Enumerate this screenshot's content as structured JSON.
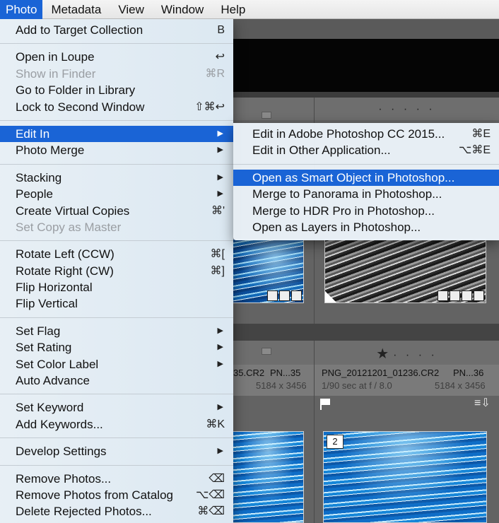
{
  "menubar": {
    "items": [
      {
        "label": "Photo",
        "active": true
      },
      {
        "label": "Metadata"
      },
      {
        "label": "View"
      },
      {
        "label": "Window"
      },
      {
        "label": "Help"
      }
    ]
  },
  "photo_menu": {
    "groups": [
      [
        {
          "label": "Add to Target Collection",
          "shortcut": "B"
        }
      ],
      [
        {
          "label": "Open in Loupe",
          "shortcut": "↩"
        },
        {
          "label": "Show in Finder",
          "shortcut": "⌘R",
          "disabled": true
        },
        {
          "label": "Go to Folder in Library",
          "shortcut": ""
        },
        {
          "label": "Lock to Second Window",
          "shortcut": "⇧⌘↩"
        }
      ],
      [
        {
          "label": "Edit In",
          "submenu": true,
          "highlighted": true
        },
        {
          "label": "Photo Merge",
          "submenu": true
        }
      ],
      [
        {
          "label": "Stacking",
          "submenu": true
        },
        {
          "label": "People",
          "submenu": true
        },
        {
          "label": "Create Virtual Copies",
          "shortcut": "⌘'"
        },
        {
          "label": "Set Copy as Master",
          "shortcut": "",
          "disabled": true
        }
      ],
      [
        {
          "label": "Rotate Left (CCW)",
          "shortcut": "⌘["
        },
        {
          "label": "Rotate Right (CW)",
          "shortcut": "⌘]"
        },
        {
          "label": "Flip Horizontal",
          "shortcut": ""
        },
        {
          "label": "Flip Vertical",
          "shortcut": ""
        }
      ],
      [
        {
          "label": "Set Flag",
          "submenu": true
        },
        {
          "label": "Set Rating",
          "submenu": true
        },
        {
          "label": "Set Color Label",
          "submenu": true
        },
        {
          "label": "Auto Advance",
          "shortcut": ""
        }
      ],
      [
        {
          "label": "Set Keyword",
          "submenu": true
        },
        {
          "label": "Add Keywords...",
          "shortcut": "⌘K"
        }
      ],
      [
        {
          "label": "Develop Settings",
          "submenu": true
        }
      ],
      [
        {
          "label": "Remove Photos...",
          "shortcut": "⌫"
        },
        {
          "label": "Remove Photos from Catalog",
          "shortcut": "⌥⌫"
        },
        {
          "label": "Delete Rejected Photos...",
          "shortcut": "⌘⌫"
        }
      ]
    ]
  },
  "edit_in_submenu": {
    "groups": [
      [
        {
          "label": "Edit in Adobe Photoshop CC 2015...",
          "shortcut": "⌘E"
        },
        {
          "label": "Edit in Other Application...",
          "shortcut": "⌥⌘E"
        }
      ],
      [
        {
          "label": "Open as Smart Object in Photoshop...",
          "highlighted": true
        },
        {
          "label": "Merge to Panorama in Photoshop..."
        },
        {
          "label": "Merge to HDR Pro in Photoshop..."
        },
        {
          "label": "Open as Layers in Photoshop..."
        }
      ]
    ]
  },
  "grid": {
    "row2_left_name": "35.CR2",
    "row2_left_index": "PN...35",
    "row2_left_dims": "5184 x 3456",
    "row2_right_name": "PNG_20121201_01236.CR2",
    "row2_right_index": "PN...36",
    "row2_right_exposure": "1/90 sec at f / 8.0",
    "row2_right_dims": "5184 x 3456",
    "row2_right_rating": 1,
    "photo_number_badge": "2"
  },
  "colors": {
    "highlight": "#1a64d6",
    "grid_bg": "#5a5a5a"
  }
}
